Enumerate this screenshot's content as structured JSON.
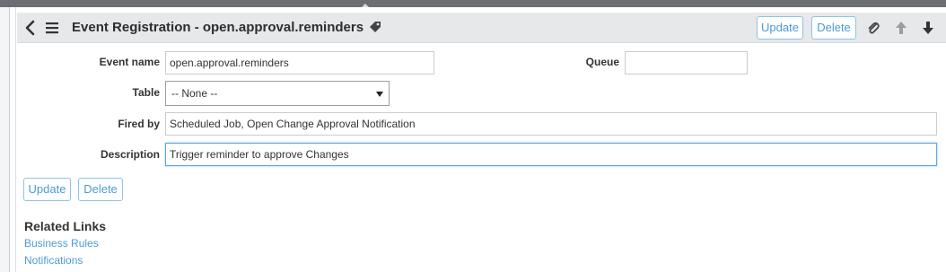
{
  "header": {
    "title": "Event Registration - open.approval.reminders",
    "update_label": "Update",
    "delete_label": "Delete"
  },
  "form": {
    "event_name": {
      "label": "Event name",
      "value": "open.approval.reminders"
    },
    "queue": {
      "label": "Queue",
      "value": ""
    },
    "table": {
      "label": "Table",
      "selected": "-- None --"
    },
    "fired_by": {
      "label": "Fired by",
      "value": "Scheduled Job, Open Change Approval Notification"
    },
    "description": {
      "label": "Description",
      "value": "Trigger reminder to approve Changes"
    }
  },
  "footer_buttons": {
    "update_label": "Update",
    "delete_label": "Delete"
  },
  "related_links": {
    "title": "Related Links",
    "links": [
      "Business Rules",
      "Notifications"
    ]
  },
  "colors": {
    "header_bg": "#e6e8ea",
    "button_text": "#4b9cd6",
    "button_border": "#8fc3e6",
    "link": "#4b9cd6",
    "focus_border": "#5aa8e0"
  },
  "icons": [
    "chevron-left-icon",
    "hamburger-menu-icon",
    "tag-icon",
    "paperclip-icon",
    "arrow-up-icon",
    "arrow-down-icon"
  ]
}
